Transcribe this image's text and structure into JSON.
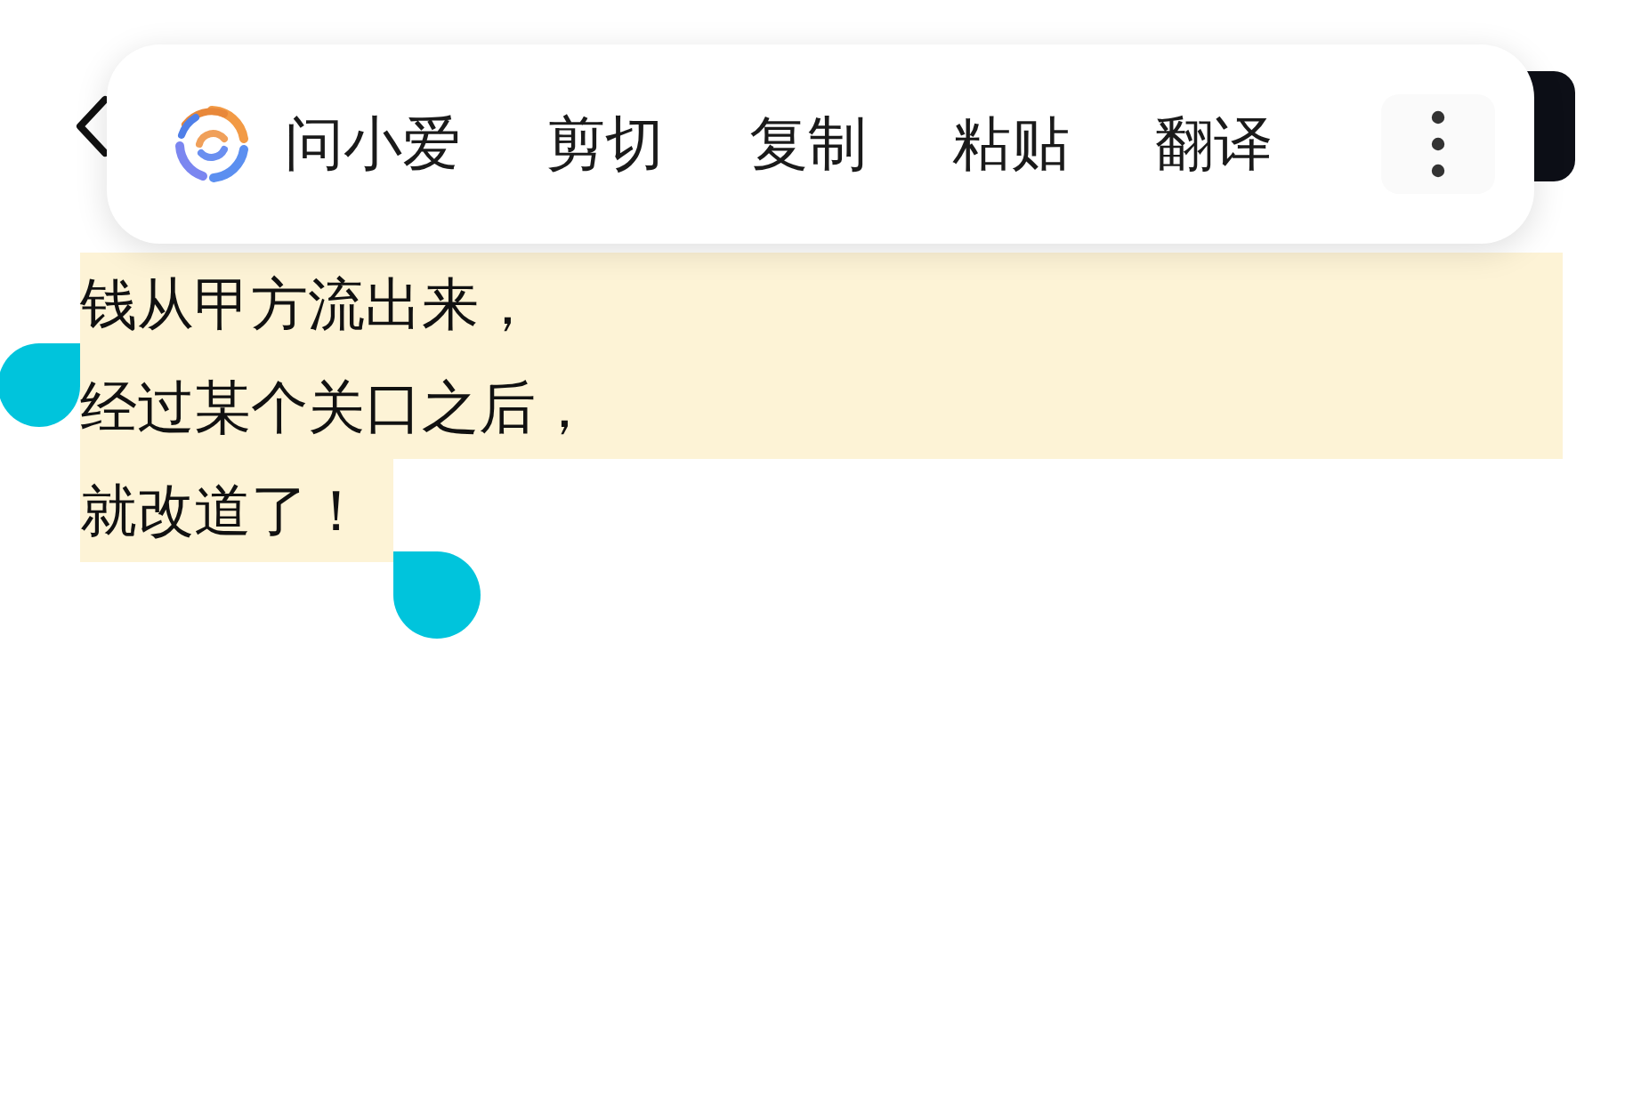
{
  "context_menu": {
    "assistant_label": "问小爱",
    "actions": [
      {
        "label": "剪切"
      },
      {
        "label": "复制"
      },
      {
        "label": "粘贴"
      },
      {
        "label": "翻译"
      }
    ]
  },
  "selection": {
    "selected": true,
    "lines": [
      "钱从甲方流出来，",
      "经过某个关口之后，",
      "就改道了！"
    ]
  }
}
